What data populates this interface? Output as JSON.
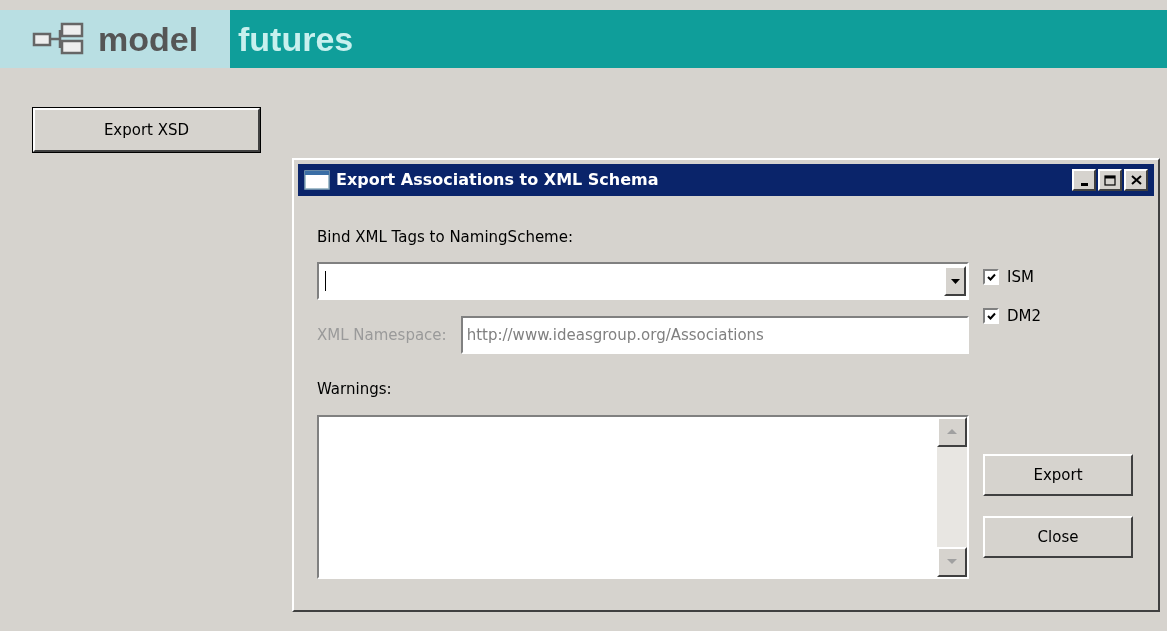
{
  "banner": {
    "brand_left": "model",
    "brand_right": "futures"
  },
  "main_button": "Export XSD",
  "dialog": {
    "title": "Export Associations to XML Schema",
    "naming_label": "Bind XML Tags to NamingScheme:",
    "namespace": {
      "label": "XML Namespace:",
      "value": "http://www.ideasgroup.org/Associations",
      "disabled": true
    },
    "checkboxes": [
      {
        "label": "ISM",
        "checked": true
      },
      {
        "label": "DM2",
        "checked": true
      }
    ],
    "warnings_label": "Warnings:",
    "buttons": [
      "Export",
      "Close"
    ]
  }
}
